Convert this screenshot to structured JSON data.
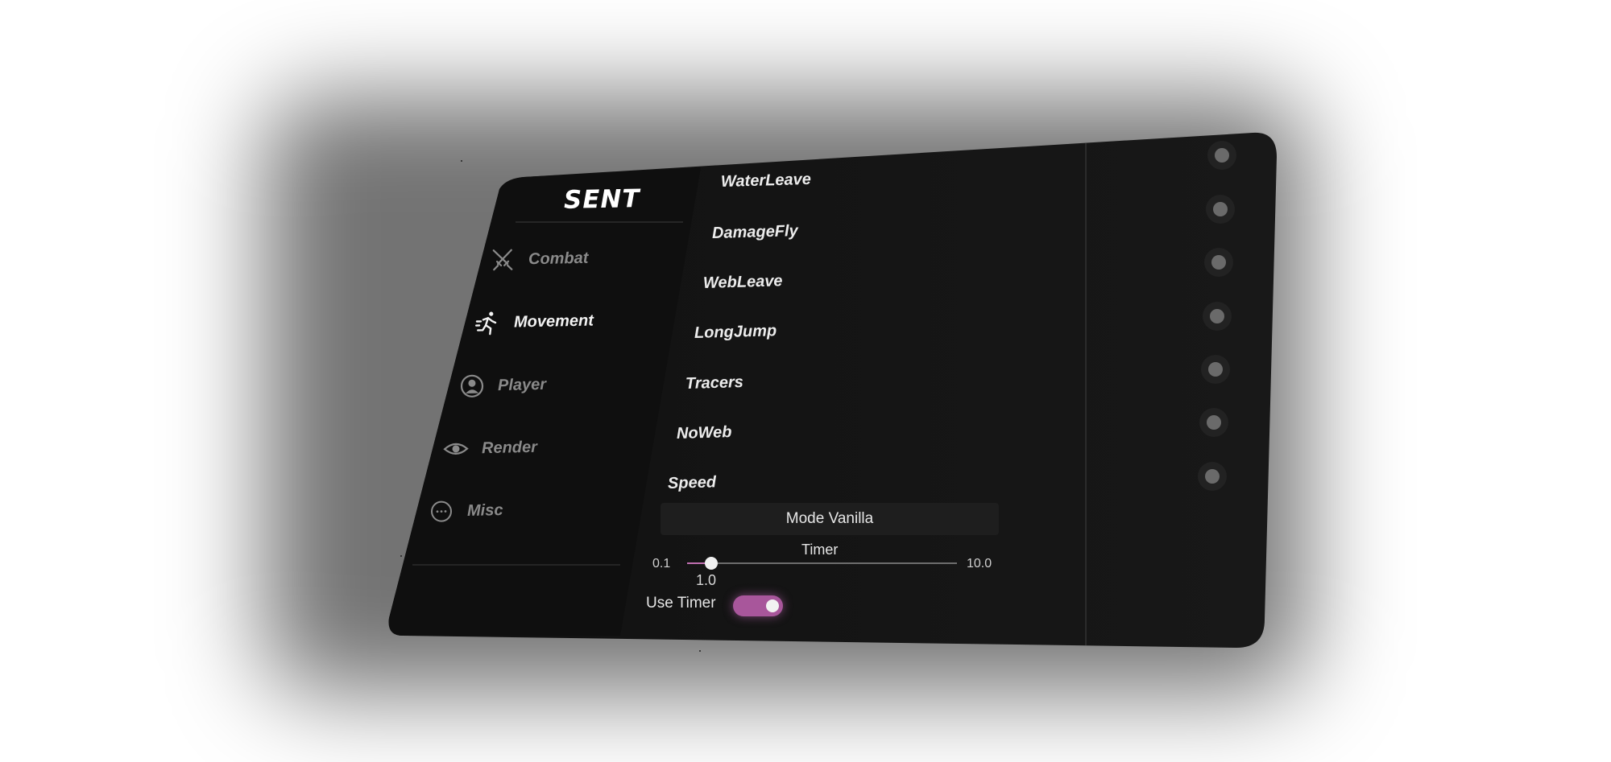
{
  "app": {
    "brand": "SENT"
  },
  "sidebar": {
    "items": [
      {
        "label": "Combat",
        "icon": "crossed-swords-icon",
        "active": false
      },
      {
        "label": "Movement",
        "icon": "running-person-icon",
        "active": true
      },
      {
        "label": "Player",
        "icon": "user-circle-icon",
        "active": false
      },
      {
        "label": "Render",
        "icon": "eye-icon",
        "active": false
      },
      {
        "label": "Misc",
        "icon": "ellipsis-circle-icon",
        "active": false
      }
    ]
  },
  "modules": [
    {
      "label": "WaterLeave",
      "enabled": false
    },
    {
      "label": "DamageFly",
      "enabled": false
    },
    {
      "label": "WebLeave",
      "enabled": false
    },
    {
      "label": "LongJump",
      "enabled": false
    },
    {
      "label": "Tracers",
      "enabled": false
    },
    {
      "label": "NoWeb",
      "enabled": false
    },
    {
      "label": "Speed",
      "enabled": false
    }
  ],
  "speed_settings": {
    "mode_label": "Mode Vanilla",
    "timer": {
      "label": "Timer",
      "min_label": "0.1",
      "max_label": "10.0",
      "min": 0.1,
      "max": 10.0,
      "value": 1.0,
      "value_label": "1.0"
    },
    "use_timer": {
      "label": "Use Timer",
      "enabled": true
    }
  },
  "colors": {
    "background": "#ffffff",
    "panel": "#151515",
    "sidebar": "#101010",
    "accent": "#a8569b",
    "text": "#ececec",
    "muted_text": "#8a8a8a"
  }
}
